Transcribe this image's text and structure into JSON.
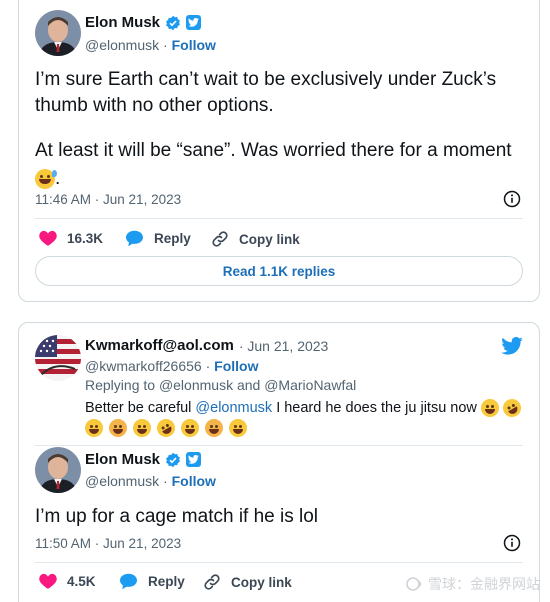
{
  "tweet1": {
    "author_name": "Elon Musk",
    "handle": "@elonmusk",
    "separator": "·",
    "follow_label": "Follow",
    "text_line1": "I’m sure Earth can’t wait to be exclusively under Zuck’s",
    "text_line2": "thumb with no other options.",
    "text_line3": "At least it will be “sane”. Was worried there for a moment",
    "timestamp": "11:46 AM · Jun 21, 2023",
    "likes": "16.3K",
    "reply_label": "Reply",
    "copy_link_label": "Copy link",
    "read_replies_label": "Read 1.1K replies"
  },
  "tweet2": {
    "author_name": "Kwmarkoff@aol.com",
    "date": "· Jun 21, 2023",
    "handle": "@kwmarkoff26656",
    "separator": "·",
    "follow_label": "Follow",
    "replying_prefix": "Replying to",
    "replying_user1": "@elonmusk",
    "replying_and": "and",
    "replying_user2": "@MarioNawfal",
    "text_before": "Better be careful",
    "text_mention": "@elonmusk",
    "text_after": "I heard he does the ju jitsu now"
  },
  "tweet3": {
    "author_name": "Elon Musk",
    "handle": "@elonmusk",
    "separator": "·",
    "follow_label": "Follow",
    "text": "I’m up for a cage match if he is lol",
    "timestamp": "11:50 AM · Jun 21, 2023",
    "likes": "4.5K",
    "reply_label": "Reply",
    "copy_link_label": "Copy link"
  },
  "watermark": {
    "text": "雪球：金融界网站"
  },
  "colors": {
    "accent": "#1d9bf0",
    "link": "#1d6fb8",
    "like": "#f91880",
    "muted": "#536471"
  }
}
